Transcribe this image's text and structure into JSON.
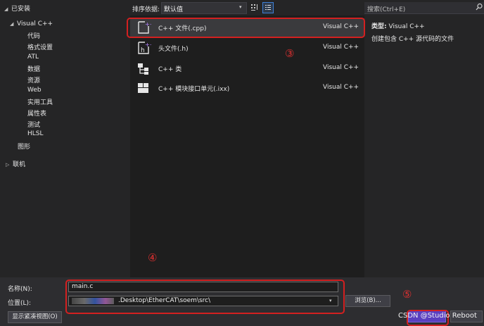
{
  "left_panel": {
    "installed_label": "已安装",
    "visual_cpp_label": "Visual C++",
    "categories": [
      "代码",
      "格式设置",
      "ATL",
      "数据",
      "资源",
      "Web",
      "实用工具",
      "属性表",
      "测试",
      "HLSL"
    ],
    "graphics_label": "图形",
    "online_label": "联机"
  },
  "toolbar": {
    "sort_label": "排序依据:",
    "sort_value": "默认值",
    "search_placeholder": "搜索(Ctrl+E)"
  },
  "templates": [
    {
      "name": "C++ 文件(.cpp)",
      "lang": "Visual C++",
      "icon": "cpp-file-icon"
    },
    {
      "name": "头文件(.h)",
      "lang": "Visual C++",
      "icon": "header-file-icon"
    },
    {
      "name": "C++ 类",
      "lang": "Visual C++",
      "icon": "class-icon"
    },
    {
      "name": "C++ 模块接口单元(.ixx)",
      "lang": "Visual C++",
      "icon": "module-icon"
    }
  ],
  "details": {
    "type_label": "类型:",
    "type_value": "Visual C++",
    "description": "创建包含 C++ 源代码的文件"
  },
  "form": {
    "name_label": "名称(N):",
    "name_value": "main.c",
    "location_label": "位置(L):",
    "location_value": ".Desktop\\EtherCAT\\soem\\src\\",
    "browse_label": "浏览(B)...",
    "compact_view_label": "显示紧凑视图(O)"
  },
  "annotations": {
    "step3": "③",
    "step4": "④",
    "step5": "⑤",
    "watermark": "CSDN @Studio Reboot"
  },
  "colors": {
    "accent_red": "#d32020",
    "selection": "#3a3a3d",
    "primary_button": "#5a3fc0"
  }
}
